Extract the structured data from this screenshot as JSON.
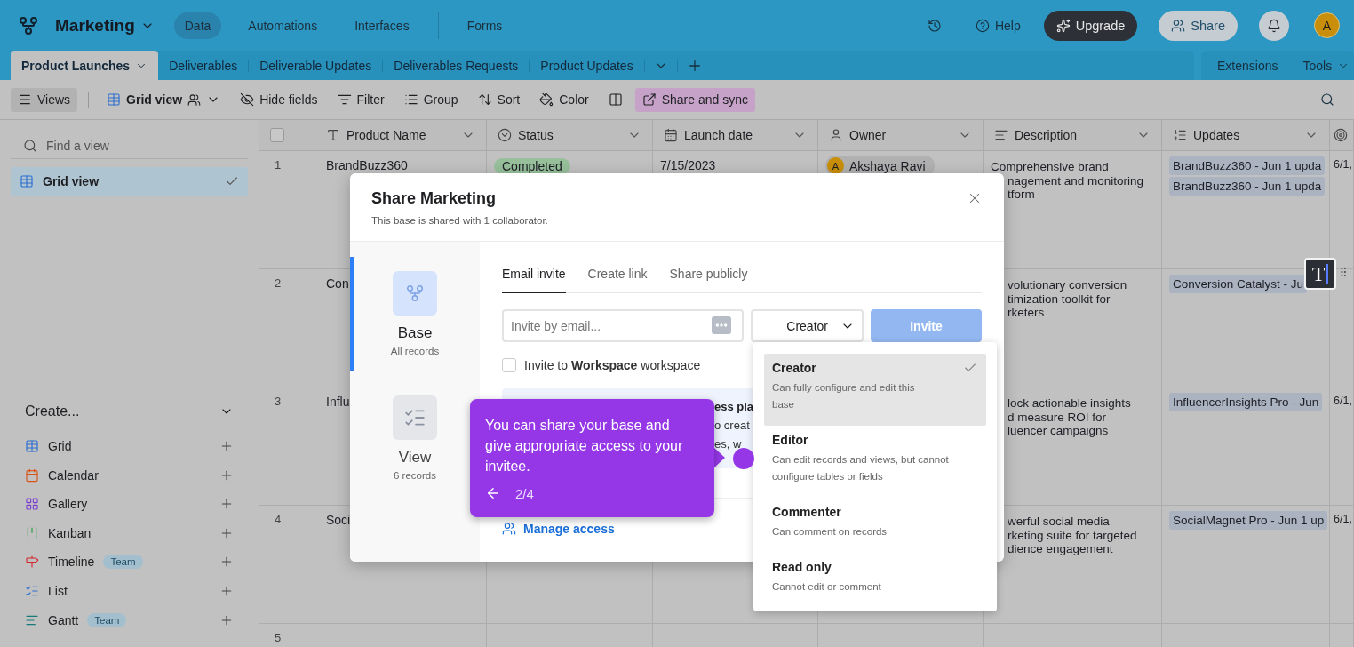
{
  "topbar": {
    "base_name": "Marketing",
    "nav_groups": [
      [
        {
          "label": "Data",
          "selected": true
        },
        {
          "label": "Automations",
          "selected": false
        },
        {
          "label": "Interfaces",
          "selected": false
        }
      ],
      [
        {
          "label": "Forms",
          "selected": false
        }
      ]
    ],
    "help": "Help",
    "upgrade": "Upgrade",
    "share": "Share",
    "avatar": "A"
  },
  "table_tabs": {
    "tabs": [
      {
        "label": "Product Launches",
        "selected": true
      },
      {
        "label": "Deliverables",
        "selected": false
      },
      {
        "label": "Deliverable Updates",
        "selected": false
      },
      {
        "label": "Deliverables Requests",
        "selected": false
      },
      {
        "label": "Product Updates",
        "selected": false
      }
    ],
    "extensions": "Extensions",
    "tools": "Tools"
  },
  "toolbar": {
    "views": "Views",
    "view_name": "Grid view",
    "items": [
      {
        "kind": "hide_fields",
        "label": "Hide fields"
      },
      {
        "kind": "filter",
        "label": "Filter"
      },
      {
        "kind": "group",
        "label": "Group"
      },
      {
        "kind": "sort",
        "label": "Sort"
      },
      {
        "kind": "color",
        "label": "Color"
      },
      {
        "kind": "row_height"
      },
      {
        "kind": "share_sync",
        "label": "Share and sync"
      }
    ]
  },
  "sidebar": {
    "search_placeholder": "Find a view",
    "views": [
      {
        "label": "Grid view",
        "selected": true
      }
    ],
    "create_title": "Create...",
    "create_items": [
      {
        "kind": "grid",
        "label": "Grid"
      },
      {
        "kind": "calendar",
        "label": "Calendar"
      },
      {
        "kind": "gallery",
        "label": "Gallery"
      },
      {
        "kind": "kanban",
        "label": "Kanban"
      },
      {
        "kind": "timeline",
        "label": "Timeline",
        "badge": "Team"
      },
      {
        "kind": "list",
        "label": "List"
      },
      {
        "kind": "gantt",
        "label": "Gantt",
        "badge": "Team"
      }
    ]
  },
  "table": {
    "select_all": {
      "checked": false
    },
    "columns": [
      {
        "kind": "text",
        "label": "Product Name"
      },
      {
        "kind": "status",
        "label": "Status"
      },
      {
        "kind": "date",
        "label": "Launch date"
      },
      {
        "kind": "user",
        "label": "Owner"
      },
      {
        "kind": "long_text",
        "label": "Description"
      },
      {
        "kind": "link",
        "label": "Updates"
      },
      {
        "kind": "other"
      }
    ],
    "rows": [
      {
        "number": "1",
        "product_name": "BrandBuzz360",
        "status": "Completed",
        "launch_date": "7/15/2023",
        "owner": {
          "initial": "A",
          "name": "Akshaya Ravi"
        },
        "description": [
          "Comprehensive brand",
          "nagement and monitoring",
          "tform"
        ],
        "updates": [
          "BrandBuzz360 - Jun 1 upda",
          "BrandBuzz360 - Jun 1 upda"
        ],
        "column_7": "6/1,"
      },
      {
        "number": "2",
        "product_name": "Con",
        "description": [
          "volutionary conversion",
          "timization toolkit for",
          "rketers"
        ],
        "updates": [
          "Conversion Catalyst - Ju"
        ]
      },
      {
        "number": "3",
        "product_name": "Influ",
        "description": [
          "lock actionable insights",
          "d measure ROI for",
          "luencer campaigns"
        ],
        "updates": [
          "InfluencerInsights Pro - Jun"
        ],
        "column_7": "6/1,"
      },
      {
        "number": "4",
        "product_name": "Soci",
        "description": [
          "werful social media",
          "rketing suite for targeted",
          "dience engagement"
        ],
        "updates": [
          "SocialMagnet Pro - Jun 1 up"
        ],
        "column_7": "6/1,"
      },
      {
        "number": "5"
      }
    ]
  },
  "text_tool": {
    "label": "T"
  },
  "share_dialog": {
    "title": "Share Marketing",
    "subtitle": "This base is shared with 1 collaborator.",
    "scopes": [
      {
        "kind": "base",
        "title": "Base",
        "detail": "All records",
        "selected": true
      },
      {
        "kind": "view",
        "title": "View",
        "detail": "6 records",
        "selected": false
      }
    ],
    "tabs": [
      {
        "label": "Email invite",
        "selected": true
      },
      {
        "label": "Create link",
        "selected": false
      },
      {
        "label": "Share publicly",
        "selected": false
      }
    ],
    "email_placeholder": "Invite by email...",
    "role": "Creator",
    "invite_button": {
      "label": "Invite",
      "disabled": true
    },
    "workspace_invite": {
      "text": "Invite to **Workspace** workspace",
      "checked": false
    },
    "notice": {
      "title": "ess pla",
      "lines": [
        "o creat",
        "es, w"
      ]
    },
    "manage_access": "Manage access"
  },
  "role_menu": {
    "options": [
      {
        "label": "Creator",
        "description": "Can fully configure and edit this base",
        "selected": true
      },
      {
        "label": "Editor",
        "description": "Can edit records and views, but cannot configure tables or fields",
        "selected": false
      },
      {
        "label": "Commenter",
        "description": "Can comment on records",
        "selected": false
      },
      {
        "label": "Read only",
        "description": "Cannot edit or comment",
        "selected": false
      }
    ]
  },
  "tour_tooltip": {
    "text": "You can share your base and give appropriate access to your invitee.",
    "step": "2/4"
  }
}
